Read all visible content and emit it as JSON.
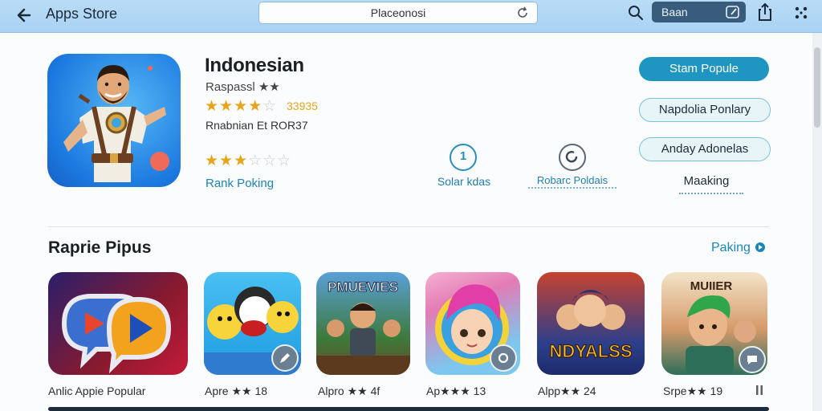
{
  "toolbar": {
    "title": "Apps Store",
    "url": "Placeonosi",
    "account_label": "Baan"
  },
  "app": {
    "name": "Indonesian",
    "subtitle": "Raspassl ★★",
    "rating_count": "33935",
    "info_line": "Rnabnian Et ROR37",
    "rank_link": "Rank Poking"
  },
  "stats": [
    {
      "value": "1",
      "label": "Solar kdas"
    },
    {
      "value": "",
      "label": "Robarc Poldais"
    }
  ],
  "buttons": {
    "primary": "Stam Popule",
    "outline1": "Napdolia Ponlary",
    "outline2": "Anday Adonelas",
    "making": "Maaking"
  },
  "section": {
    "title": "Raprie Pipus",
    "link": "Paking"
  },
  "tiles": [
    {
      "label": "Anlic Appie Popular",
      "title": ""
    },
    {
      "label": "Apre ★★ 18",
      "title": ""
    },
    {
      "label": "Alpro ★★ 4f",
      "title": "PMUEVIES"
    },
    {
      "label": "Ap★★★ 13",
      "title": ""
    },
    {
      "label": "Alpp★★ 24",
      "title": "NDYALSS"
    },
    {
      "label": "Srpe★★ 19",
      "title": "MUIIER"
    }
  ],
  "colors": {
    "accent": "#1f96c2",
    "star": "#e8a41a",
    "topbar": "#b0d6f4"
  }
}
